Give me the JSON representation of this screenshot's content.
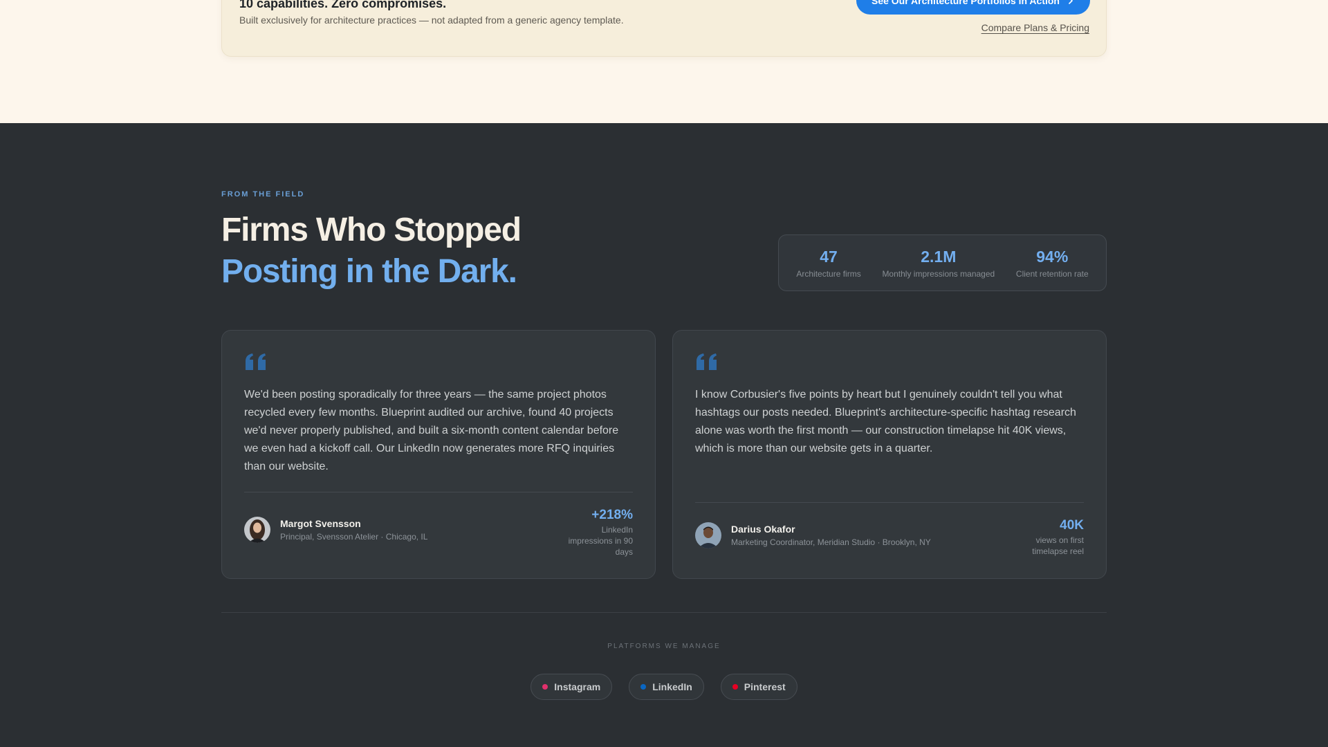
{
  "cta": {
    "title": "10 capabilities. Zero compromises.",
    "subtitle": "Built exclusively for architecture practices — not adapted from a generic agency template.",
    "primary_label": "See Our Architecture Portfolios in Action",
    "secondary_label": "Compare Plans & Pricing"
  },
  "testimonials_section": {
    "eyebrow": "FROM THE FIELD",
    "headline_line1": "Firms Who Stopped",
    "headline_line2": "Posting in the Dark.",
    "stats": [
      {
        "value": "47",
        "label": "Architecture firms"
      },
      {
        "value": "2.1M",
        "label": "Monthly impressions managed"
      },
      {
        "value": "94%",
        "label": "Client retention rate"
      }
    ],
    "testimonials": [
      {
        "quote": "We'd been posting sporadically for three years — the same project photos recycled every few months. Blueprint audited our archive, found 40 projects we'd never properly published, and built a six-month content calendar before we even had a kickoff call. Our LinkedIn now generates more RFQ inquiries than our website.",
        "name": "Margot Svensson",
        "role": "Principal, Svensson Atelier · Chicago, IL",
        "metric_value": "+218%",
        "metric_label": "LinkedIn impressions in 90 days"
      },
      {
        "quote": "I know Corbusier's five points by heart but I genuinely couldn't tell you what hashtags our posts needed. Blueprint's architecture-specific hashtag research alone was worth the first month — our construction timelapse hit 40K views, which is more than our website gets in a quarter.",
        "name": "Darius Okafor",
        "role": "Marketing Coordinator, Meridian Studio · Brooklyn, NY",
        "metric_value": "40K",
        "metric_label": "views on first timelapse reel"
      }
    ],
    "platforms_label": "PLATFORMS WE MANAGE",
    "platforms": [
      {
        "name": "Instagram",
        "color": "#e1306c"
      },
      {
        "name": "LinkedIn",
        "color": "#0a66c2"
      },
      {
        "name": "Pinterest",
        "color": "#e60023"
      }
    ]
  },
  "colors": {
    "accent_blue": "#1f7ee8",
    "highlight_blue": "#72afee",
    "dark_bg": "#2b2f33",
    "cream_bg": "#fdf6ec"
  }
}
